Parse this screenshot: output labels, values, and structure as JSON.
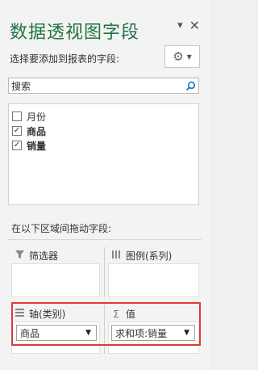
{
  "pane": {
    "title": "数据透视图字段",
    "controls": {
      "dropdown_icon": "▾",
      "close_icon": "✕"
    }
  },
  "chooser": {
    "label": "选择要添加到报表的字段:",
    "settings_icon": "gear-icon"
  },
  "search": {
    "placeholder": "搜索",
    "value": "搜索"
  },
  "fields": [
    {
      "label": "月份",
      "checked": false
    },
    {
      "label": "商品",
      "checked": true
    },
    {
      "label": "销量",
      "checked": true
    }
  ],
  "areas_label": "在以下区域间拖动字段:",
  "areas": {
    "filters": {
      "label": "筛选器"
    },
    "legend": {
      "label": "图例(系列)"
    },
    "axis": {
      "label": "轴(类别)",
      "item": "商品"
    },
    "values": {
      "label": "值",
      "item": "求和项:销量"
    }
  },
  "colors": {
    "title": "#217346",
    "highlight": "#e53935"
  }
}
